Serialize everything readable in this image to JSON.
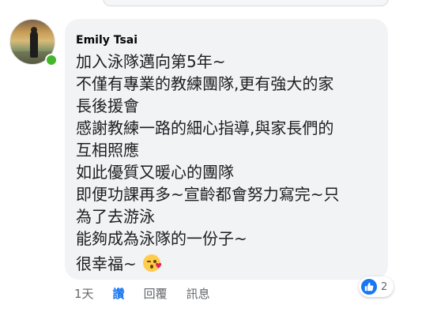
{
  "comment": {
    "author": "Emily Tsai",
    "lines": [
      "加入泳隊邁向第5年~",
      "不僅有專業的教練團隊,更有強大的家",
      "長後援會",
      "感謝教練一路的細心指導,與家長們的",
      "互相照應",
      "如此優質又暖心的團隊",
      "即便功課再多~宣齡都會努力寫完~只",
      "為了去游泳",
      "能夠成為泳隊的一份子~"
    ],
    "closing_text": "很幸福~",
    "closing_emoji": "face-blowing-kiss-emoji"
  },
  "actions": {
    "time": "1天",
    "like": "讚",
    "reply": "回覆",
    "message": "訊息"
  },
  "reactions": {
    "count": "2",
    "icon": "thumbs-up-icon"
  },
  "colors": {
    "bubble": "#f2f3f5",
    "like_blue": "#1877f2",
    "online_green": "#42b72a",
    "secondary_text": "#65676b"
  }
}
